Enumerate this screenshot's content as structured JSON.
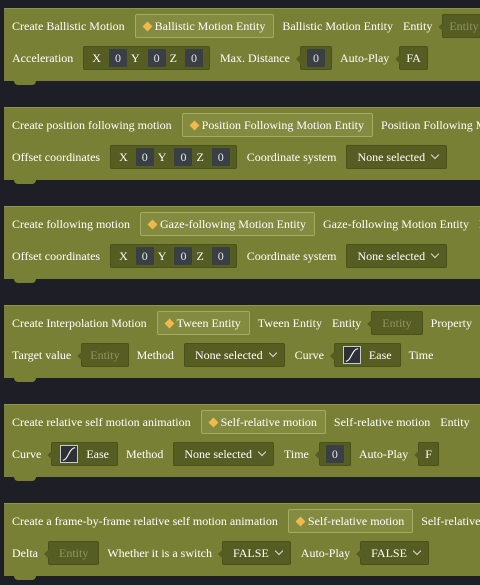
{
  "blocks": [
    {
      "row1": {
        "label": "Create Ballistic Motion",
        "chip": "Ballistic Motion Entity",
        "label2": "Ballistic Motion Entity",
        "label3": "Entity",
        "entity_placeholder": "Entity"
      },
      "row2": {
        "label": "Acceleration",
        "x_label": "X",
        "x": "0",
        "y_label": "Y",
        "y": "0",
        "z_label": "Z",
        "z": "0",
        "distance_label": "Max. Distance",
        "distance": "0",
        "autoplay_label": "Auto-Play",
        "autoplay": "FA"
      }
    },
    {
      "row1": {
        "label": "Create position following motion",
        "chip": "Position Following Motion Entity",
        "label2": "Position Following Mo"
      },
      "row2": {
        "label": "Offset coordinates",
        "x_label": "X",
        "x": "0",
        "y_label": "Y",
        "y": "0",
        "z_label": "Z",
        "z": "0",
        "coord_label": "Coordinate system",
        "coord_value": "None selected"
      }
    },
    {
      "row1": {
        "label": "Create following motion",
        "chip": "Gaze-following Motion Entity",
        "label2": "Gaze-following Motion Entity",
        "label3": "En"
      },
      "row2": {
        "label": "Offset coordinates",
        "x_label": "X",
        "x": "0",
        "y_label": "Y",
        "y": "0",
        "z_label": "Z",
        "z": "0",
        "coord_label": "Coordinate system",
        "coord_value": "None selected"
      }
    },
    {
      "row1": {
        "label": "Create Interpolation Motion",
        "chip": "Tween Entity",
        "label2": "Tween Entity",
        "label3": "Entity",
        "entity_placeholder": "Entity",
        "property_label": "Property"
      },
      "row2": {
        "label": "Target value",
        "target_placeholder": "Entity",
        "method_label": "Method",
        "method_value": "None selected",
        "curve_label": "Curve",
        "curve_value": "Ease",
        "time_label": "Time"
      }
    },
    {
      "row1": {
        "label": "Create relative self motion animation",
        "chip": "Self-relative motion",
        "label2": "Self-relative motion",
        "label3": "Entity"
      },
      "row2": {
        "label": "Curve",
        "curve_value": "Ease",
        "method_label": "Method",
        "method_value": "None selected",
        "time_label": "Time",
        "time_value": "0",
        "autoplay_label": "Auto-Play",
        "autoplay": "F"
      }
    },
    {
      "row1": {
        "label": "Create a frame-by-frame relative self motion animation",
        "chip": "Self-relative motion",
        "label2": "Self-relative n"
      },
      "row2": {
        "label": "Delta",
        "delta_placeholder": "Entity",
        "switch_label": "Whether it is a switch",
        "switch_value": "FALSE",
        "autoplay_label": "Auto-Play",
        "autoplay": "FALSE"
      }
    }
  ],
  "icons": {
    "diamond": "diamond-icon",
    "chevron": "chevron-down-icon",
    "curve": "ease-curve-icon"
  },
  "colors": {
    "background": "#1e1f26",
    "block": "#788036",
    "input": "#565d22",
    "accent": "#f2b84a"
  }
}
